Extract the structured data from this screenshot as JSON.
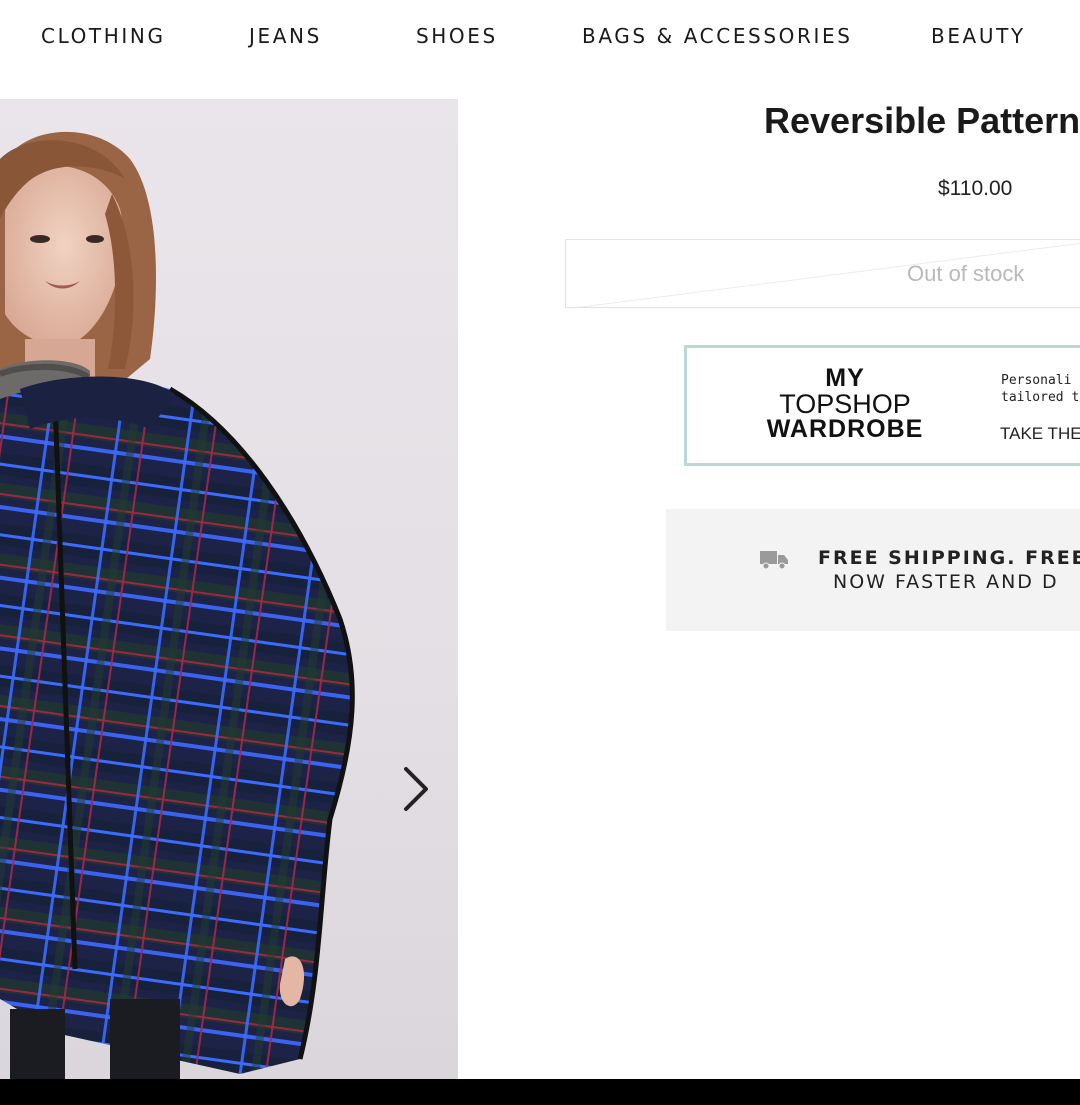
{
  "nav": {
    "items": [
      {
        "label": "CLOTHING"
      },
      {
        "label": "JEANS"
      },
      {
        "label": "SHOES"
      },
      {
        "label": "BAGS & ACCESSORIES"
      },
      {
        "label": "BEAUTY"
      }
    ]
  },
  "product": {
    "title": "Reversible Pattern",
    "price": "$110.00",
    "stock_status": "Out of stock",
    "image": {
      "subject": "model in blue plaid cape",
      "icon": "chevron-right-icon"
    }
  },
  "wardrobe_banner": {
    "logo": {
      "line1": "MY",
      "line2": "TOPSHOP",
      "line3": "WARDROBE"
    },
    "desc_line1": "Personali",
    "desc_line2": "tailored t",
    "cta": "TAKE THE"
  },
  "shipping_banner": {
    "icon": "truck-icon",
    "line1": "FREE SHIPPING. FREE",
    "line2": "NOW FASTER AND D"
  },
  "colors": {
    "wardrobe_border": "#b9d9d5",
    "shipping_bg": "#f3f3f3",
    "stock_text": "#b9b9b9",
    "bottom_bar": "#000000"
  }
}
